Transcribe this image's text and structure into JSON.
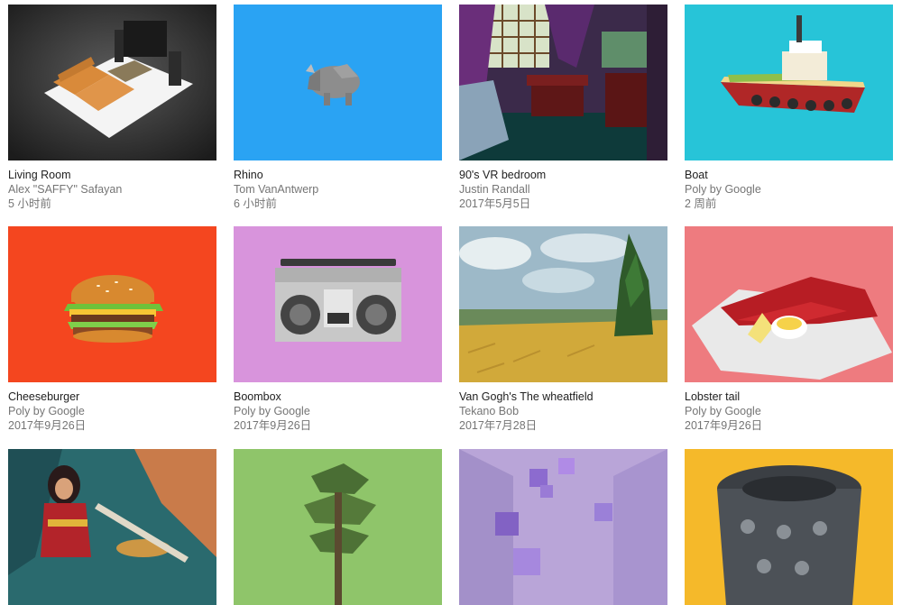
{
  "cards": [
    {
      "title": "Living Room",
      "author": "Alex \"SAFFY\" Safayan",
      "date": "5 小时前",
      "thumbnail": "living-room-model"
    },
    {
      "title": "Rhino",
      "author": "Tom VanAntwerp",
      "date": "6 小时前",
      "thumbnail": "rhino-model"
    },
    {
      "title": "90's VR bedroom",
      "author": "Justin Randall",
      "date": "2017年5月5日",
      "thumbnail": "bedroom-model"
    },
    {
      "title": "Boat",
      "author": "Poly by Google",
      "date": "2 周前",
      "thumbnail": "boat-model"
    },
    {
      "title": "Cheeseburger",
      "author": "Poly by Google",
      "date": "2017年9月26日",
      "thumbnail": "cheeseburger-model"
    },
    {
      "title": "Boombox",
      "author": "Poly by Google",
      "date": "2017年9月26日",
      "thumbnail": "boombox-model"
    },
    {
      "title": "Van Gogh's The wheatfield",
      "author": "Tekano Bob",
      "date": "2017年7月28日",
      "thumbnail": "wheatfield-painting"
    },
    {
      "title": "Lobster tail",
      "author": "Poly by Google",
      "date": "2017年9月26日",
      "thumbnail": "lobster-tail-model"
    },
    {
      "thumbnail": "wonder-woman-art"
    },
    {
      "thumbnail": "tree-model"
    },
    {
      "thumbnail": "purple-cubes-room"
    },
    {
      "thumbnail": "camera-rig-model"
    }
  ]
}
